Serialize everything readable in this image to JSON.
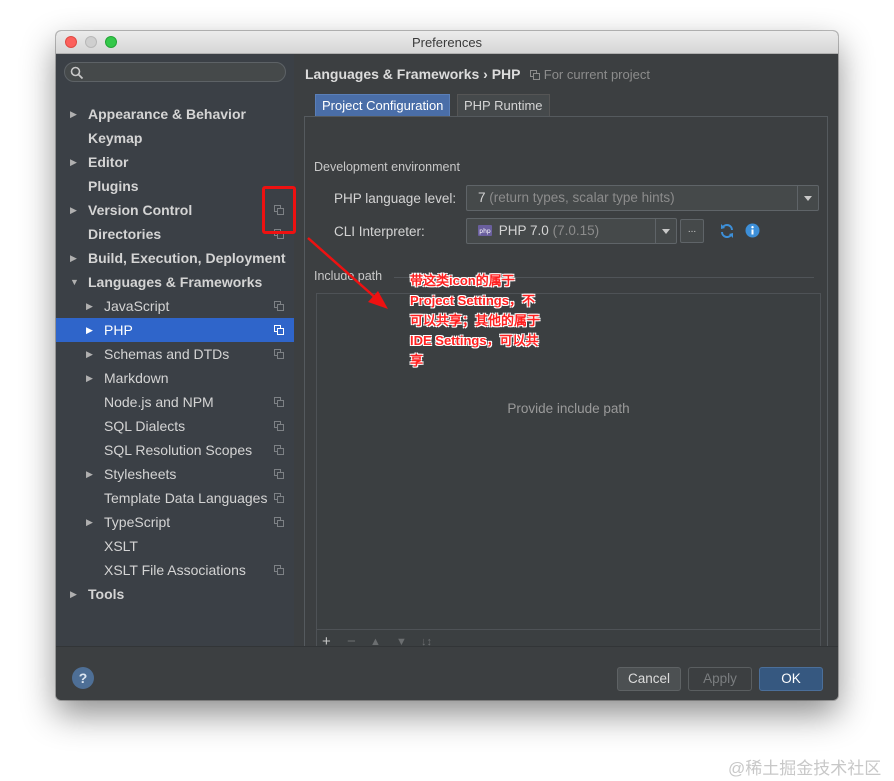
{
  "window": {
    "title": "Preferences"
  },
  "sidebar": {
    "items": [
      {
        "label": "Appearance & Behavior",
        "arrow": "▶",
        "bold": true,
        "indent": 0,
        "project": false,
        "selected": false
      },
      {
        "label": "Keymap",
        "arrow": "",
        "bold": true,
        "indent": 0,
        "project": false,
        "selected": false
      },
      {
        "label": "Editor",
        "arrow": "▶",
        "bold": true,
        "indent": 0,
        "project": false,
        "selected": false
      },
      {
        "label": "Plugins",
        "arrow": "",
        "bold": true,
        "indent": 0,
        "project": false,
        "selected": false
      },
      {
        "label": "Version Control",
        "arrow": "▶",
        "bold": true,
        "indent": 0,
        "project": true,
        "selected": false
      },
      {
        "label": "Directories",
        "arrow": "",
        "bold": true,
        "indent": 0,
        "project": true,
        "selected": false
      },
      {
        "label": "Build, Execution, Deployment",
        "arrow": "▶",
        "bold": true,
        "indent": 0,
        "project": false,
        "selected": false
      },
      {
        "label": "Languages & Frameworks",
        "arrow": "▼",
        "bold": true,
        "indent": 0,
        "project": false,
        "selected": false
      },
      {
        "label": "JavaScript",
        "arrow": "▶",
        "bold": false,
        "indent": 1,
        "project": true,
        "selected": false
      },
      {
        "label": "PHP",
        "arrow": "▶",
        "bold": false,
        "indent": 1,
        "project": true,
        "selected": true
      },
      {
        "label": "Schemas and DTDs",
        "arrow": "▶",
        "bold": false,
        "indent": 1,
        "project": true,
        "selected": false
      },
      {
        "label": "Markdown",
        "arrow": "▶",
        "bold": false,
        "indent": 1,
        "project": false,
        "selected": false
      },
      {
        "label": "Node.js and NPM",
        "arrow": "",
        "bold": false,
        "indent": 1,
        "project": true,
        "selected": false
      },
      {
        "label": "SQL Dialects",
        "arrow": "",
        "bold": false,
        "indent": 1,
        "project": true,
        "selected": false
      },
      {
        "label": "SQL Resolution Scopes",
        "arrow": "",
        "bold": false,
        "indent": 1,
        "project": true,
        "selected": false
      },
      {
        "label": "Stylesheets",
        "arrow": "▶",
        "bold": false,
        "indent": 1,
        "project": true,
        "selected": false
      },
      {
        "label": "Template Data Languages",
        "arrow": "",
        "bold": false,
        "indent": 1,
        "project": true,
        "selected": false
      },
      {
        "label": "TypeScript",
        "arrow": "▶",
        "bold": false,
        "indent": 1,
        "project": true,
        "selected": false
      },
      {
        "label": "XSLT",
        "arrow": "",
        "bold": false,
        "indent": 1,
        "project": false,
        "selected": false
      },
      {
        "label": "XSLT File Associations",
        "arrow": "",
        "bold": false,
        "indent": 1,
        "project": true,
        "selected": false
      },
      {
        "label": "Tools",
        "arrow": "▶",
        "bold": true,
        "indent": 0,
        "project": false,
        "selected": false
      }
    ]
  },
  "breadcrumb": {
    "path": "Languages & Frameworks › PHP",
    "scope": "For current project"
  },
  "tabs": [
    {
      "label": "Project Configuration",
      "active": true
    },
    {
      "label": "PHP Runtime",
      "active": false
    }
  ],
  "dev_env": {
    "section_label": "Development environment",
    "language_level_label": "PHP language level:",
    "language_level_value": "7",
    "language_level_hint": "(return types, scalar type hints)",
    "cli_label": "CLI Interpreter:",
    "cli_value": "PHP 7.0",
    "cli_version": "(7.0.15)",
    "ellipsis": "..."
  },
  "include_path": {
    "section_label": "Include path",
    "empty_text": "Provide include path"
  },
  "footer": {
    "help": "?",
    "cancel": "Cancel",
    "apply": "Apply",
    "ok": "OK"
  },
  "annotation": {
    "line1": "带这类icon的属于",
    "line2": "Project Settings，不",
    "line3": "可以共享；其他的属于",
    "line4": "IDE Settings，可以共",
    "line5": "享"
  },
  "watermark": "@稀土掘金技术社区",
  "colors": {
    "selection": "#2f65ca",
    "annotation": "#ff2020",
    "ok_button": "#365880"
  }
}
